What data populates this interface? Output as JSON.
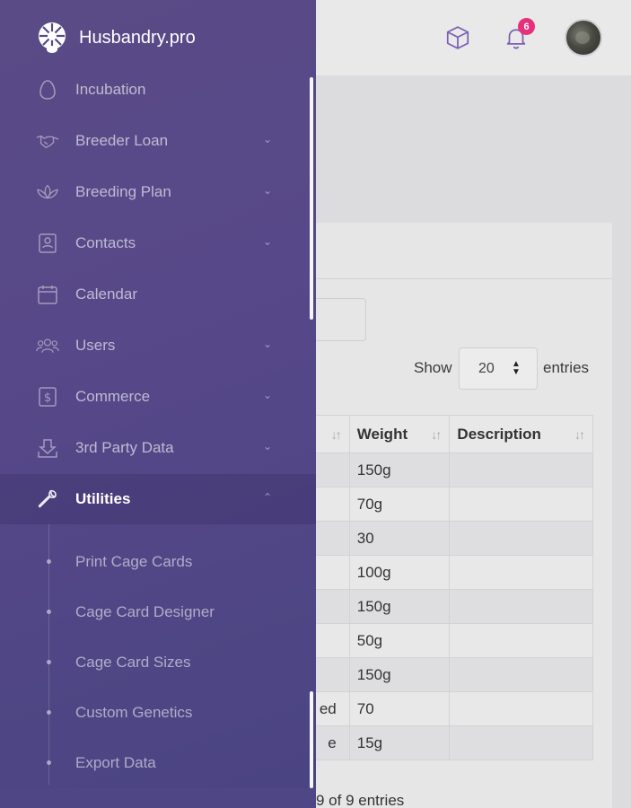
{
  "app": {
    "name": "Husbandry.pro"
  },
  "header": {
    "notification_count": "6",
    "icons": [
      "cube-icon",
      "bell-icon"
    ]
  },
  "sidebar": {
    "items": [
      {
        "label": "Incubation",
        "icon": "egg-icon",
        "has_submenu": false
      },
      {
        "label": "Breeder Loan",
        "icon": "handshake-icon",
        "has_submenu": true
      },
      {
        "label": "Breeding Plan",
        "icon": "lotus-icon",
        "has_submenu": true
      },
      {
        "label": "Contacts",
        "icon": "contact-card-icon",
        "has_submenu": true
      },
      {
        "label": "Calendar",
        "icon": "calendar-icon",
        "has_submenu": false
      },
      {
        "label": "Users",
        "icon": "users-icon",
        "has_submenu": true
      },
      {
        "label": "Commerce",
        "icon": "dollar-icon",
        "has_submenu": true
      },
      {
        "label": "3rd Party Data",
        "icon": "upload-icon",
        "has_submenu": true
      },
      {
        "label": "Utilities",
        "icon": "wrench-icon",
        "has_submenu": true,
        "expanded": true
      }
    ],
    "utilities_submenu": [
      "Print Cage Cards",
      "Cage Card Designer",
      "Cage Card Sizes",
      "Custom Genetics",
      "Export Data"
    ]
  },
  "table_controls": {
    "show_label": "Show",
    "page_size": "20",
    "entries_label": "entries"
  },
  "table": {
    "columns": [
      "",
      "Weight",
      "Description"
    ],
    "rows": [
      {
        "c0": "",
        "weight": "150g",
        "desc": ""
      },
      {
        "c0": "",
        "weight": "70g",
        "desc": ""
      },
      {
        "c0": "",
        "weight": "30",
        "desc": ""
      },
      {
        "c0": "",
        "weight": "100g",
        "desc": ""
      },
      {
        "c0": "",
        "weight": "150g",
        "desc": ""
      },
      {
        "c0": "",
        "weight": "50g",
        "desc": ""
      },
      {
        "c0": "",
        "weight": "150g",
        "desc": ""
      },
      {
        "c0": "ed",
        "weight": "70",
        "desc": ""
      },
      {
        "c0": "e",
        "weight": "15g",
        "desc": ""
      }
    ],
    "info": "9 of 9 entries"
  },
  "colors": {
    "sidebar_bg": "#574889",
    "badge": "#e8307a",
    "accent_icon": "#7d5fb3"
  }
}
